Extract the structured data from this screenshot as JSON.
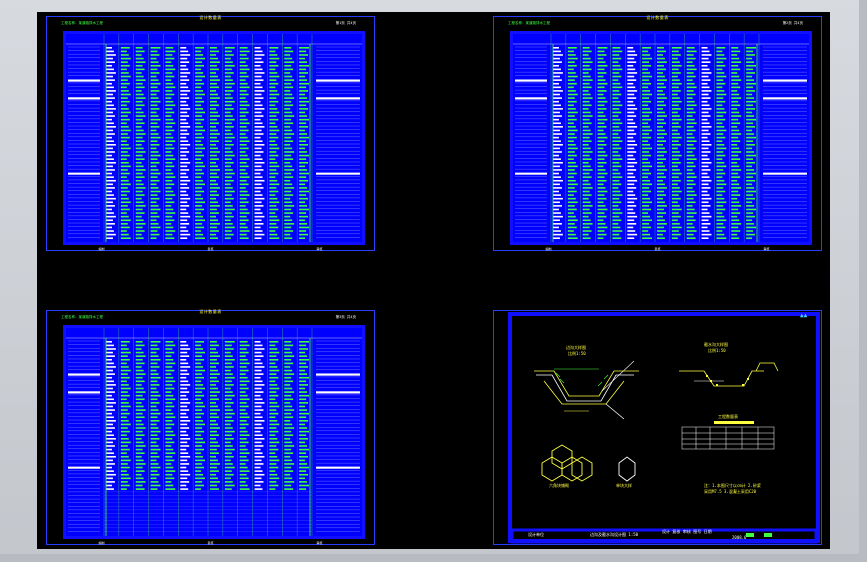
{
  "sheets": [
    {
      "id": "a",
      "title": "设计数量表",
      "meta_left": "工程名称：某道路排水工程",
      "meta_right": "第1页 共4页",
      "footer": [
        "编制",
        "复核",
        "审核"
      ]
    },
    {
      "id": "b",
      "title": "设计数量表",
      "meta_left": "工程名称：某道路排水工程",
      "meta_right": "第2页 共4页",
      "footer": [
        "编制",
        "复核",
        "审核"
      ]
    },
    {
      "id": "c",
      "title": "设计数量表",
      "meta_left": "工程名称：某道路排水工程",
      "meta_right": "第3页 共4页",
      "footer": [
        "编制",
        "复核",
        "审核"
      ]
    }
  ],
  "detail_sheet": {
    "labels": {
      "ditch_a": "边沟大样图",
      "ditch_a_sub": "比例1:50",
      "ditch_b": "截水沟大样图",
      "ditch_b_sub": "比例1:50",
      "qty_table": "工程数量表",
      "hex_a": "六角块铺砌",
      "hex_b": "单块大样",
      "notes": "注：1.本图尺寸以cm计 2.砂浆采用M7.5 3.混凝土采用C20"
    },
    "title_block": {
      "company": "设计单位",
      "drawing_name": "边沟及截水沟设计图 1:50",
      "fields": "设计 复核 审核 图号 日期",
      "sheet_no": "2008.6"
    }
  },
  "colors": {
    "background": "#000000",
    "frame": "#2a3cff",
    "table_fill": "#0000ff",
    "text_green": "#40ff40",
    "text_yellow": "#ffff40",
    "text_white": "#ffffff"
  }
}
